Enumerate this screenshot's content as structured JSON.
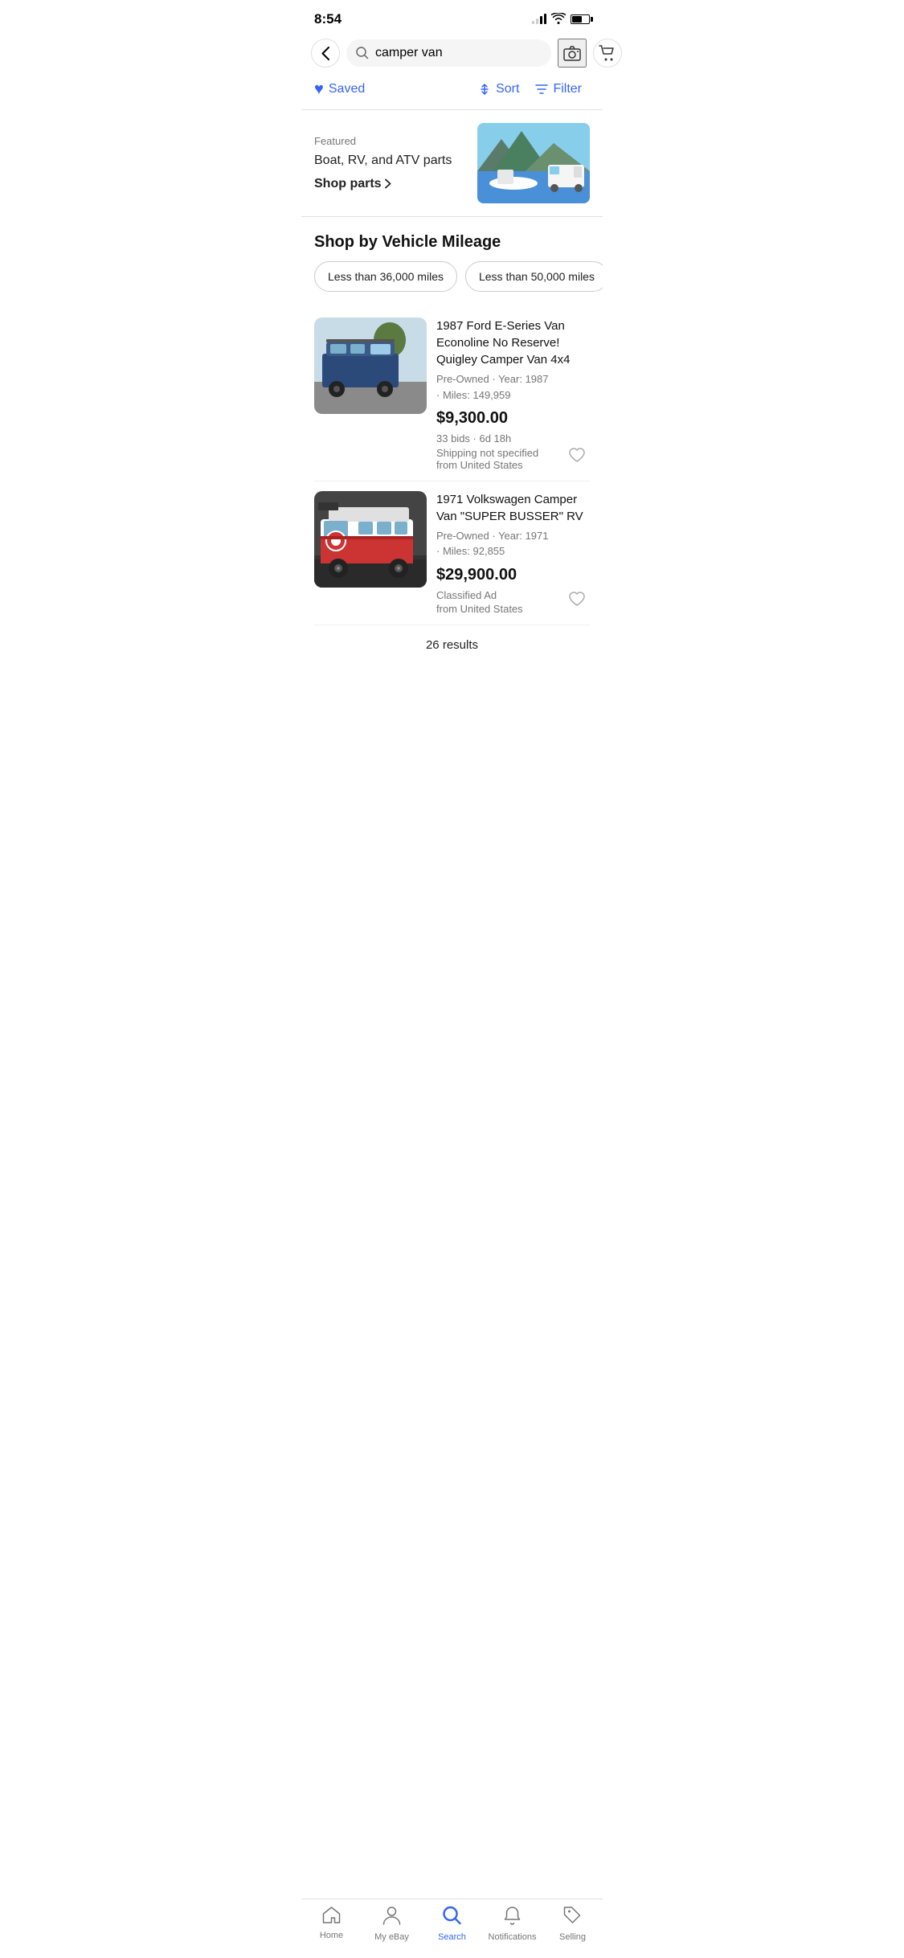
{
  "statusBar": {
    "time": "8:54",
    "signalBars": [
      1,
      2,
      3,
      4
    ],
    "signalActive": 2
  },
  "searchBar": {
    "query": "camper van",
    "placeholder": "camper van"
  },
  "toolbar": {
    "saved_label": "Saved",
    "sort_label": "Sort",
    "filter_label": "Filter"
  },
  "featured": {
    "label": "Featured",
    "title": "Boat, RV, and ATV parts",
    "shopPartsLabel": "Shop parts"
  },
  "shopByMileage": {
    "title": "Shop by Vehicle Mileage",
    "chips": [
      {
        "label": "Less than 36,000 miles"
      },
      {
        "label": "Less than 50,000 miles"
      }
    ]
  },
  "listings": [
    {
      "title": "1987 Ford E-Series Van Econoline No Reserve! Quigley Camper Van 4x4",
      "condition": "Pre-Owned",
      "year": "1987",
      "miles": "149,959",
      "price": "$9,300.00",
      "bids": "33 bids · 6d 18h",
      "shipping": "Shipping not specified",
      "location": "from United States"
    },
    {
      "title": "1971 Volkswagen Camper Van \"SUPER BUSSER\" RV",
      "condition": "Pre-Owned",
      "year": "1971",
      "miles": "92,855",
      "price": "$29,900.00",
      "bids": "Classified Ad",
      "shipping": "",
      "location": "from United States"
    }
  ],
  "results": {
    "count": "26 results"
  },
  "bottomNav": {
    "items": [
      {
        "label": "Home",
        "icon": "home",
        "active": false
      },
      {
        "label": "My eBay",
        "icon": "person",
        "active": false
      },
      {
        "label": "Search",
        "icon": "search",
        "active": true
      },
      {
        "label": "Notifications",
        "icon": "bell",
        "active": false
      },
      {
        "label": "Selling",
        "icon": "tag",
        "active": false
      }
    ]
  }
}
